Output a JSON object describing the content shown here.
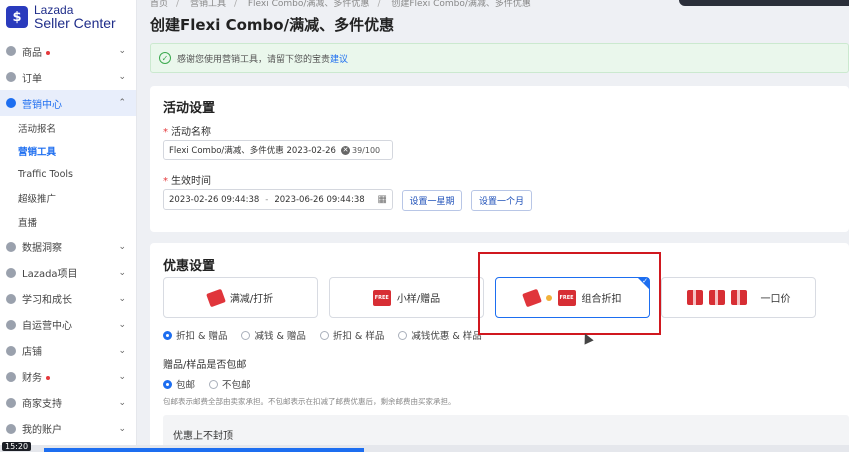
{
  "brand": {
    "logo": "$",
    "line1": "Lazada",
    "line2": "Seller Center"
  },
  "breadcrumb": [
    "首页",
    "营销工具",
    "Flexi Combo/满减、多件优惠",
    "创建Flexi Combo/满减、多件优惠"
  ],
  "page_title": "创建Flexi Combo/满减、多件优惠",
  "notice": {
    "text": "感谢您使用营销工具，请留下您的宝贵",
    "link": "建议"
  },
  "sidebar": {
    "items_top": [
      {
        "label": "商品",
        "dot": true
      },
      {
        "label": "订单",
        "dot": false
      },
      {
        "label": "营销中心",
        "dot": false
      }
    ],
    "submenu": [
      "活动报名",
      "营销工具",
      "Traffic Tools",
      "超级推广",
      "直播"
    ],
    "items_bottom": [
      {
        "label": "数据洞察",
        "dot": false
      },
      {
        "label": "Lazada项目",
        "dot": false
      },
      {
        "label": "学习和成长",
        "dot": false
      },
      {
        "label": "自运营中心",
        "dot": false
      },
      {
        "label": "店铺",
        "dot": false
      },
      {
        "label": "财务",
        "dot": true
      },
      {
        "label": "商家支持",
        "dot": false
      },
      {
        "label": "我的账户",
        "dot": false
      }
    ]
  },
  "activity": {
    "title": "活动设置",
    "name_label": "活动名称",
    "name_value": "Flexi Combo/满减、多件优惠 2023-02-26 09:",
    "name_counter": "39/100",
    "time_label": "生效时间",
    "start": "2023-02-26 09:44:38",
    "end": "2023-06-26 09:44:38",
    "btn_week": "设置一星期",
    "btn_month": "设置一个月"
  },
  "discount": {
    "title": "优惠设置",
    "options": [
      "满减/打折",
      "小样/赠品",
      "组合折扣",
      "一口价"
    ],
    "radios": [
      "折扣 & 赠品",
      "减钱 & 赠品",
      "折扣 & 样品",
      "减钱优惠 & 样品"
    ],
    "shipping_label": "赠品/样品是否包邮",
    "shipping_options": [
      "包邮",
      "不包邮"
    ],
    "hint": "包邮表示邮费全部由卖家承担。不包邮表示在扣减了邮费优惠后，剩余邮费由买家承担。",
    "cap_label": "优惠上不封顶",
    "free_tag": "FREE"
  },
  "timecode": "15:20",
  "colors": {
    "accent": "#1d6ef0",
    "highlight": "#d0181f",
    "tag": "#e0353b"
  }
}
